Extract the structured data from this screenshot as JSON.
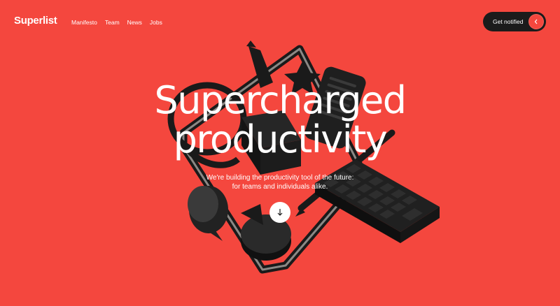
{
  "brand": {
    "logo": "Superlist"
  },
  "nav": {
    "items": [
      "Manifesto",
      "Team",
      "News",
      "Jobs"
    ]
  },
  "cta": {
    "label": "Get notified"
  },
  "hero": {
    "title_line1": "Supercharged",
    "title_line2": "productivity",
    "subtitle_line1": "We're building the productivity tool of the future:",
    "subtitle_line2": "for teams and individuals alike."
  },
  "colors": {
    "background": "#F4473E",
    "dark": "#1b1b1b",
    "text": "#ffffff"
  }
}
